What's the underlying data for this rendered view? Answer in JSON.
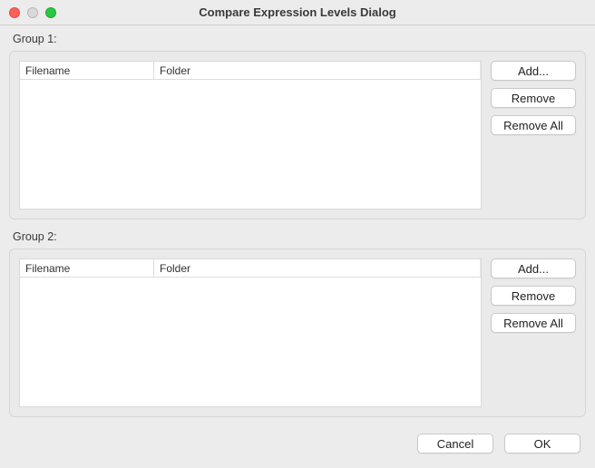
{
  "window": {
    "title": "Compare Expression Levels Dialog"
  },
  "groups": [
    {
      "label": "Group 1:",
      "columns": {
        "filename": "Filename",
        "folder": "Folder"
      },
      "rows": [],
      "buttons": {
        "add": "Add...",
        "remove": "Remove",
        "remove_all": "Remove All"
      }
    },
    {
      "label": "Group 2:",
      "columns": {
        "filename": "Filename",
        "folder": "Folder"
      },
      "rows": [],
      "buttons": {
        "add": "Add...",
        "remove": "Remove",
        "remove_all": "Remove All"
      }
    }
  ],
  "footer": {
    "cancel": "Cancel",
    "ok": "OK"
  }
}
